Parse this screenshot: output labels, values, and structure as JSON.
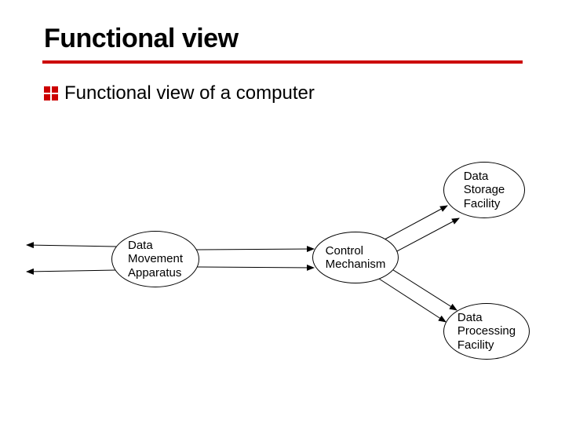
{
  "title": "Functional view",
  "bullet": "Functional view of a computer",
  "colors": {
    "accent": "#cc0000"
  },
  "nodes": {
    "storage": "Data\nStorage\nFacility",
    "movement": "Data\nMovement\nApparatus",
    "control": "Control\nMechanism",
    "processing": "Data\nProcessing\nFacility"
  }
}
